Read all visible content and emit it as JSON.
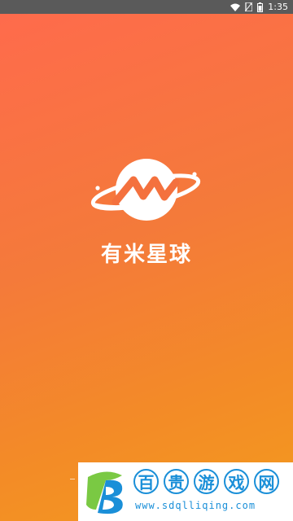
{
  "status_bar": {
    "time": "1:35",
    "icons": [
      "wifi-icon",
      "no-sim-icon",
      "battery-icon"
    ],
    "background": "#5a5a5a"
  },
  "splash": {
    "brand_name": "有米星球",
    "logo_icon": "planet-m-logo-icon",
    "gradient_start": "#ff6a4d",
    "gradient_end": "#f39a1e"
  },
  "watermark": {
    "title_chars": [
      "百",
      "贵",
      "游",
      "戏",
      "网"
    ],
    "url": "www.sdqlliqing.com",
    "color": "#1a8fd8"
  }
}
